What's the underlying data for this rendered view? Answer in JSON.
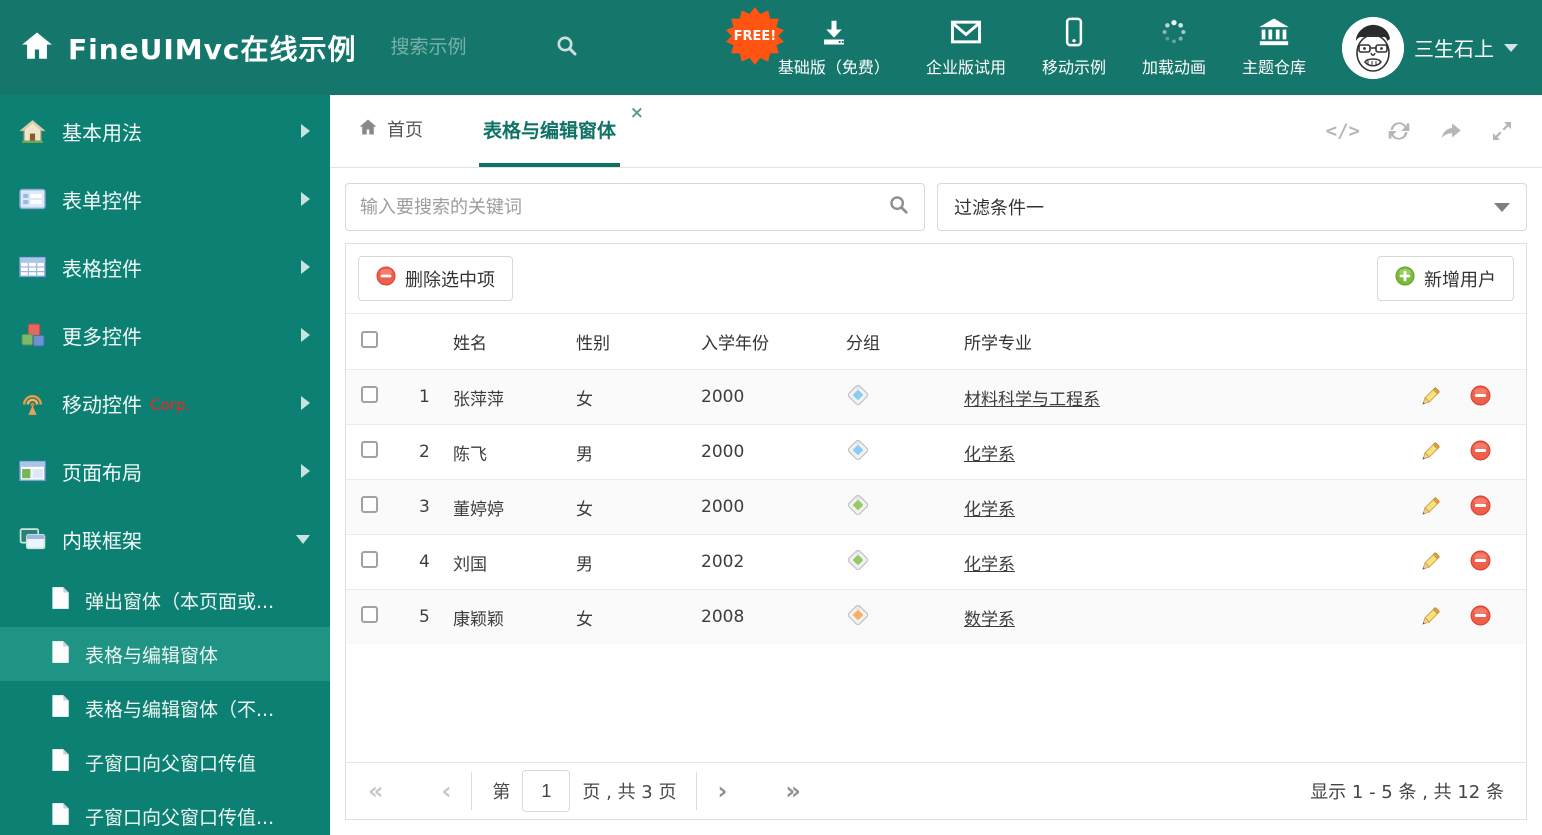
{
  "colors": {
    "header_bg": "#15776b",
    "sidebar_bg": "#0c8173",
    "sidebar_selected": "#1f9384",
    "accent": "#0e7265",
    "free_badge": "#ff5412"
  },
  "header": {
    "title": "FineUIMvc在线示例",
    "search_placeholder": "搜索示例",
    "free_badge": "FREE!",
    "nav": [
      {
        "label": "基础版（免费）",
        "icon": "download-icon"
      },
      {
        "label": "企业版试用",
        "icon": "envelope-icon"
      },
      {
        "label": "移动示例",
        "icon": "mobile-icon"
      },
      {
        "label": "加载动画",
        "icon": "spinner-icon"
      },
      {
        "label": "主题仓库",
        "icon": "bank-icon"
      }
    ],
    "username": "三生石上"
  },
  "sidebar": {
    "items": [
      {
        "label": "基本用法",
        "icon": "home-icon"
      },
      {
        "label": "表单控件",
        "icon": "form-icon"
      },
      {
        "label": "表格控件",
        "icon": "table-icon"
      },
      {
        "label": "更多控件",
        "icon": "cubes-icon"
      },
      {
        "label": "移动控件",
        "badge": "Corp.",
        "icon": "antenna-icon"
      },
      {
        "label": "页面布局",
        "icon": "layout-icon"
      },
      {
        "label": "内联框架",
        "icon": "frames-icon"
      }
    ],
    "subitems": [
      {
        "label": "弹出窗体（本页面或..."
      },
      {
        "label": "表格与编辑窗体",
        "selected": true
      },
      {
        "label": "表格与编辑窗体（不..."
      },
      {
        "label": "子窗口向父窗口传值"
      },
      {
        "label": "子窗口向父窗口传值..."
      }
    ]
  },
  "tabs": {
    "home": "首页",
    "active": "表格与编辑窗体",
    "close": "×"
  },
  "content": {
    "search_placeholder": "输入要搜索的关键词",
    "filter_value": "过滤条件一",
    "toolbar": {
      "delete": "删除选中项",
      "add": "新增用户"
    },
    "table": {
      "columns": {
        "name": "姓名",
        "gender": "性别",
        "year": "入学年份",
        "group": "分组",
        "major": "所学专业"
      },
      "rows": [
        {
          "num": "1",
          "name": "张萍萍",
          "gender": "女",
          "year": "2000",
          "tag_color": "#8cccf4",
          "major": "材料科学与工程系"
        },
        {
          "num": "2",
          "name": "陈飞",
          "gender": "男",
          "year": "2000",
          "tag_color": "#8cccf4",
          "major": "化学系"
        },
        {
          "num": "3",
          "name": "董婷婷",
          "gender": "女",
          "year": "2000",
          "tag_color": "#96c967",
          "major": "化学系"
        },
        {
          "num": "4",
          "name": "刘国",
          "gender": "男",
          "year": "2002",
          "tag_color": "#96c967",
          "major": "化学系"
        },
        {
          "num": "5",
          "name": "康颖颖",
          "gender": "女",
          "year": "2008",
          "tag_color": "#f6b064",
          "major": "数学系"
        }
      ]
    },
    "pager": {
      "first": "«",
      "prev": "‹",
      "prefix": "第",
      "page": "1",
      "suffix": "页 , 共 3 页",
      "next": "›",
      "last": "»",
      "summary": "显示 1 - 5 条 , 共 12 条"
    }
  }
}
